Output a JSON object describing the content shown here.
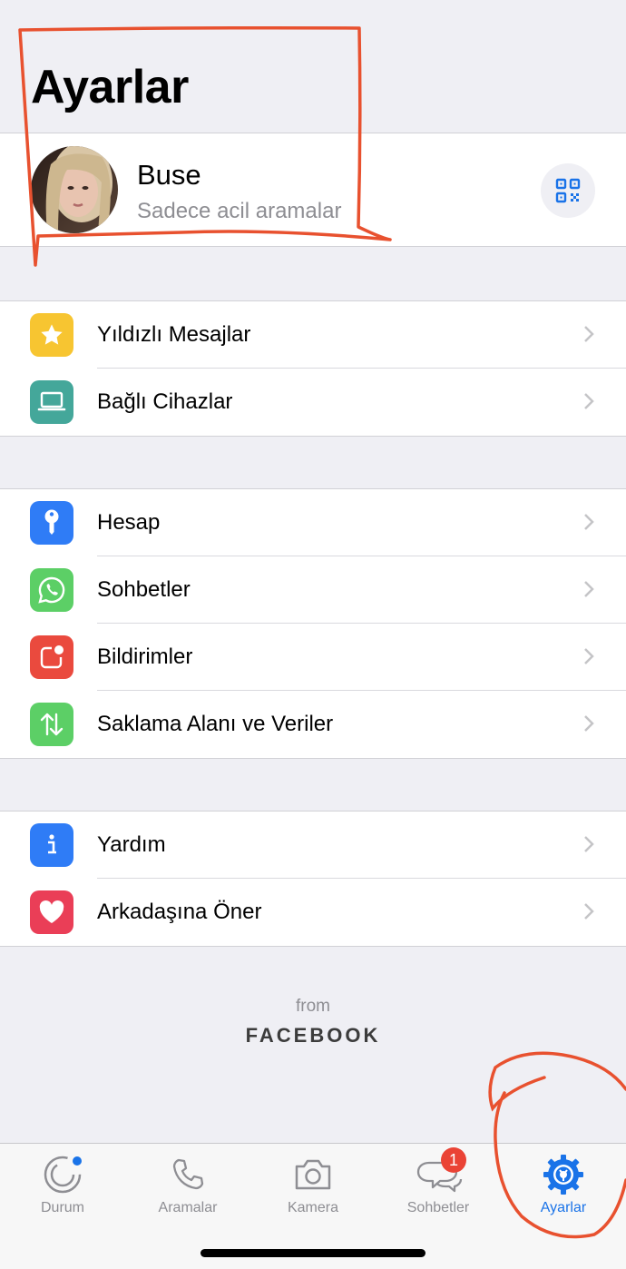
{
  "page": {
    "title": "Ayarlar"
  },
  "profile": {
    "name": "Buse",
    "status": "Sadece acil aramalar"
  },
  "groups": [
    {
      "items": [
        {
          "label": "Yıldızlı Mesajlar",
          "icon": "star-icon",
          "color": "#f7c531"
        },
        {
          "label": "Bağlı Cihazlar",
          "icon": "laptop-icon",
          "color": "#44a79a"
        }
      ]
    },
    {
      "items": [
        {
          "label": "Hesap",
          "icon": "key-icon",
          "color": "#2f7cf6"
        },
        {
          "label": "Sohbetler",
          "icon": "whatsapp-icon",
          "color": "#5ccf66"
        },
        {
          "label": "Bildirimler",
          "icon": "notification-icon",
          "color": "#ea4a3e"
        },
        {
          "label": "Saklama Alanı ve Veriler",
          "icon": "storage-arrows-icon",
          "color": "#5ccf66"
        }
      ]
    },
    {
      "items": [
        {
          "label": "Yardım",
          "icon": "info-icon",
          "color": "#2f7cf6"
        },
        {
          "label": "Arkadaşına Öner",
          "icon": "heart-icon",
          "color": "#ea3e57"
        }
      ]
    }
  ],
  "footer": {
    "from": "from",
    "brand": "FACEBOOK"
  },
  "tabbar": {
    "tabs": [
      {
        "label": "Durum",
        "icon": "status-icon"
      },
      {
        "label": "Aramalar",
        "icon": "phone-icon"
      },
      {
        "label": "Kamera",
        "icon": "camera-icon"
      },
      {
        "label": "Sohbetler",
        "icon": "chats-icon",
        "badge": "1"
      },
      {
        "label": "Ayarlar",
        "icon": "settings-gear-icon",
        "active": true
      }
    ]
  },
  "colors": {
    "accent": "#1a73e8",
    "annotation": "#e8512f",
    "badge": "#ea4335"
  }
}
